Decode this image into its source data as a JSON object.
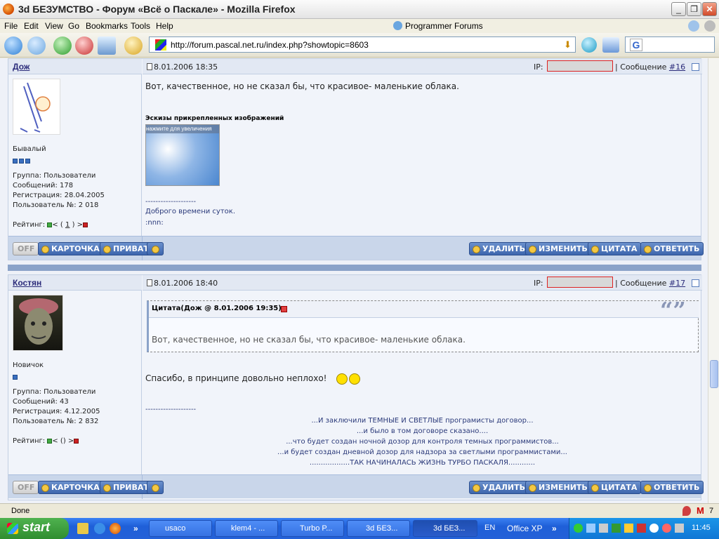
{
  "window": {
    "title": "3d БЕЗУМСТВО - Форум «Всё о Паскале» - Mozilla Firefox"
  },
  "menu": {
    "items": [
      "File",
      "Edit",
      "View",
      "Go",
      "Bookmarks",
      "Tools",
      "Help"
    ],
    "programmer_forums": "Programmer Forums"
  },
  "nav": {
    "url": "http://forum.pascal.net.ru/index.php?showtopic=8603"
  },
  "posts": [
    {
      "author": "Дож",
      "date": "8.01.2006 18:35",
      "ip_label": "IP:",
      "msg_label": "| Сообщение",
      "msg_num": "#16",
      "rank": "Бывалый",
      "rank_squares": 3,
      "meta": [
        "Группа: Пользователи",
        "Сообщений: 178",
        "Регистрация: 28.04.2005",
        "Пользователь №: 2 018"
      ],
      "rating_label": "Рейтинг:",
      "rating_open": "< (",
      "rating_val": "1",
      "rating_close": ") >",
      "text": "Вот, качественное, но не сказал бы, что красивое- маленькие облака.",
      "attach_title": "Эскизы прикрепленных изображений",
      "attach_hint": "нажмите для увеличения",
      "sig_line": "--------------------",
      "sig": [
        "Доброго времени суток.",
        ":nnn:"
      ]
    },
    {
      "author": "Костян",
      "date": "8.01.2006 18:40",
      "ip_label": "IP:",
      "msg_label": "| Сообщение",
      "msg_num": "#17",
      "rank": "Новичок",
      "rank_squares": 1,
      "meta": [
        "Группа: Пользователи",
        "Сообщений: 43",
        "Регистрация: 4.12.2005",
        "Пользователь №: 2 832"
      ],
      "rating_label": "Рейтинг:",
      "rating_open": "< (",
      "rating_val": "",
      "rating_close": ") >",
      "quote_head": "Цитата(Дож @ 8.01.2006 19:35)",
      "quote_text": "Вот, качественное, но не сказал бы, что красивое- маленькие облака.",
      "text": "Спасибо, в принципе довольно неплохо!",
      "sig_line": "--------------------",
      "sig": [
        "...И заключили ТЕМНЫЕ И СВЕТЛЫЕ програмисты договор...",
        "...и было в том договоре сказано....",
        "...что будет создан ночной дозор для контроля темных программистов...",
        "...и будет создан дневной дозор для надзора за светлыми программистами...",
        "..................ТАК НАЧИНАЛАСЬ ЖИЗНЬ ТУРБО ПАСКАЛЯ............"
      ]
    }
  ],
  "buttons": {
    "off": "OFF",
    "card": "КАРТОЧКА",
    "private": "ПРИВАТ",
    "delete": "УДАЛИТЬ",
    "edit": "ИЗМЕНИТЬ",
    "quote": "ЦИТАТА",
    "reply": "ОТВЕТИТЬ"
  },
  "status": {
    "text": "Done",
    "mail_count": "7"
  },
  "taskbar": {
    "start": "start",
    "tasks": [
      "usaco",
      "klem4 - ...",
      "Turbo P...",
      "3d БЕЗ...",
      "3d БЕЗ..."
    ],
    "lang": "EN",
    "office": "Office XP",
    "clock": "11:45"
  }
}
